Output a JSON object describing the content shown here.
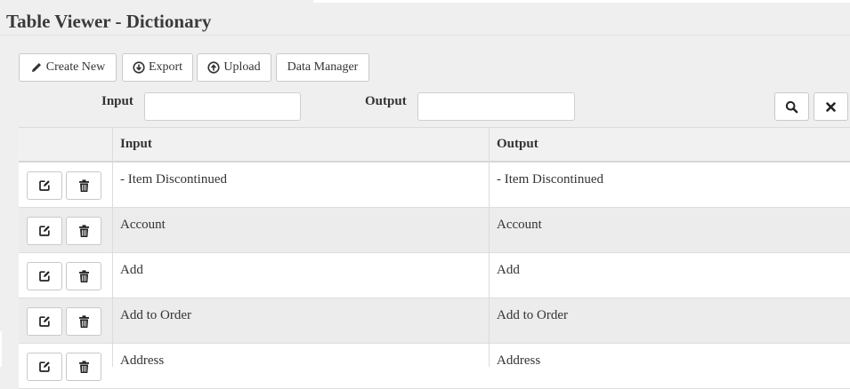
{
  "page": {
    "title": "Table Viewer - Dictionary"
  },
  "toolbar": {
    "create_new": {
      "label": "Create New",
      "icon": "pencil-icon"
    },
    "export": {
      "label": "Export",
      "icon": "download-circle-icon"
    },
    "upload": {
      "label": "Upload",
      "icon": "upload-circle-icon"
    },
    "data_manager": {
      "label": "Data Manager"
    }
  },
  "filters": {
    "input_label": "Input",
    "input_value": "",
    "output_label": "Output",
    "output_value": "",
    "search_icon": "search-icon",
    "clear_icon": "close-icon"
  },
  "table": {
    "columns": [
      "",
      "Input",
      "Output"
    ],
    "row_actions": [
      "edit-icon",
      "trash-icon"
    ],
    "rows": [
      {
        "input": "- Item Discontinued",
        "output": "- Item Discontinued"
      },
      {
        "input": "Account",
        "output": "Account"
      },
      {
        "input": "Add",
        "output": "Add"
      },
      {
        "input": "Add to Order",
        "output": "Add to Order"
      },
      {
        "input": "Address",
        "output": "Address"
      }
    ]
  },
  "colors": {
    "background": "#efefef",
    "row_alt": "#ececec",
    "border": "#c9c9c9"
  }
}
